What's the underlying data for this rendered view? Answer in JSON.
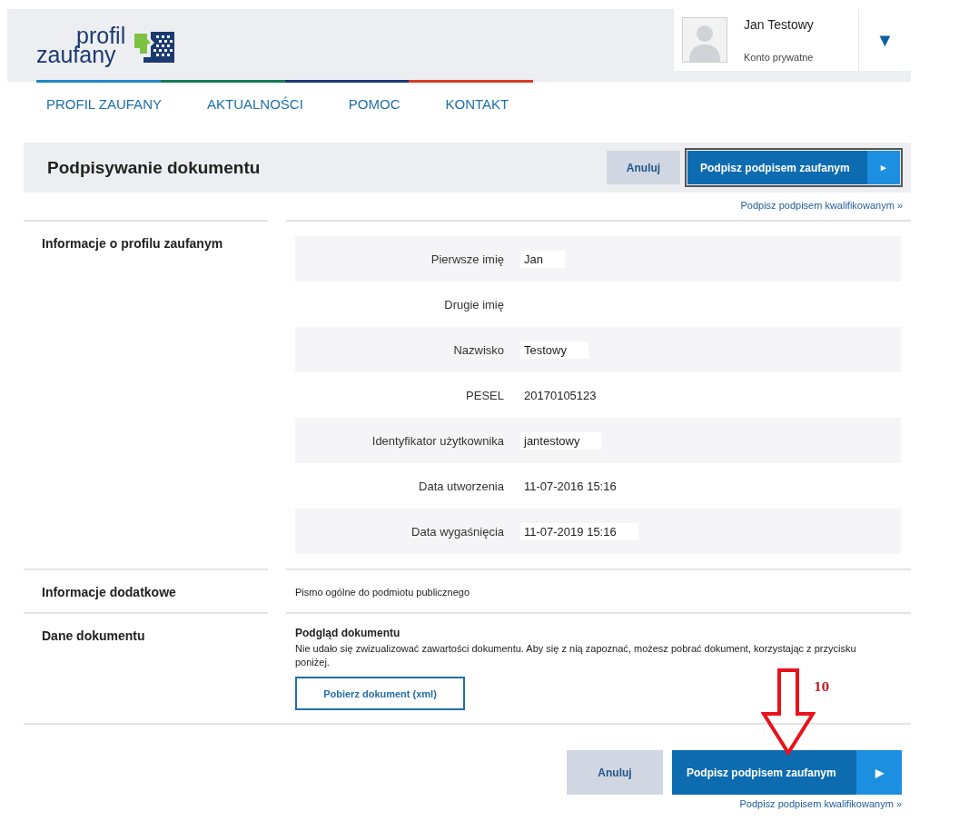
{
  "logo": {
    "line_1": "profil",
    "line_2": "zaufany"
  },
  "user": {
    "name": "Jan Testowy",
    "account": "Konto prywatne",
    "menu_icon": "▼"
  },
  "nav": [
    {
      "label": "PROFIL ZAUFANY",
      "color": "#1e88c8"
    },
    {
      "label": "AKTUALNOŚCI",
      "color": "#157a5a"
    },
    {
      "label": "POMOC",
      "color": "#1b3a70"
    },
    {
      "label": "KONTAKT",
      "color": "#d63a2a"
    }
  ],
  "page_title": "Podpisywanie dokumentu",
  "top_actions": {
    "cancel": "Anuluj",
    "sign": "Podpisz podpisem zaufanym",
    "sign_icon": "▸",
    "qualified_link": "Podpisz podpisem kwalifikowanym »"
  },
  "profile_section": {
    "heading": "Informacje o profilu zaufanym",
    "fields": [
      {
        "label": "Pierwsze imię",
        "value": "Jan"
      },
      {
        "label": "Drugie imię"
      },
      {
        "label": "Nazwisko",
        "value": "Testowy"
      },
      {
        "label": "PESEL",
        "value": "20170105123"
      },
      {
        "label": "Identyfikator użytkownika",
        "value": "jantestowy"
      },
      {
        "label": "Data utworzenia",
        "value": "11-07-2016 15:16"
      },
      {
        "label": "Data wygaśnięcia",
        "value": "11-07-2019 15:16"
      }
    ]
  },
  "additional_section": {
    "heading": "Informacje dodatkowe",
    "text": "Pismo ogólne do podmiotu publicznego"
  },
  "document_section": {
    "heading": "Dane dokumentu",
    "preview_title": "Podgląd dokumentu",
    "message": "Nie udało się zwizualizować zawartości dokumentu. Aby się z nią zapoznać, możesz pobrać dokument, korzystając z przycisku poniżej.",
    "download_button": "Pobierz dokument (xml)"
  },
  "bottom_actions": {
    "cancel": "Anuluj",
    "sign": "Podpisz podpisem zaufanym",
    "sign_icon": "▶",
    "qualified_link": "Podpisz podpisem kwalifikowanym »"
  },
  "annotation": {
    "label": "10"
  }
}
